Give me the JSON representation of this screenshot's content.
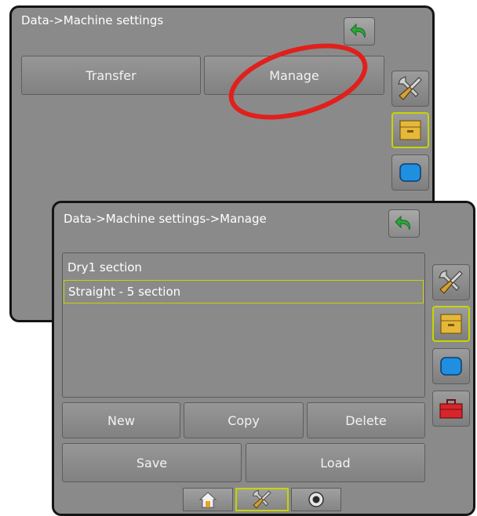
{
  "back_window": {
    "title": "Data->Machine settings",
    "buttons": {
      "transfer": "Transfer",
      "manage": "Manage"
    }
  },
  "front_window": {
    "title": "Data->Machine settings->Manage",
    "list_items": [
      "Dry1 section",
      "Straight - 5 section"
    ],
    "selected_index": 1,
    "buttons": {
      "new": "New",
      "copy": "Copy",
      "delete": "Delete",
      "save": "Save",
      "load": "Load"
    }
  },
  "sidebar_icons": [
    "tools-icon",
    "file-cabinet-icon",
    "monitor-icon",
    "toolbox-icon"
  ],
  "bottom_tabs": [
    "home-icon",
    "tools-icon",
    "camera-icon"
  ],
  "active_bottom_tab": "tools-icon",
  "highlight_annotation": "red-ellipse-around-manage-button",
  "colors": {
    "selection_outline": "#c6d400",
    "window_bg": "#8a8a8a",
    "annotation": "#e0201c"
  }
}
